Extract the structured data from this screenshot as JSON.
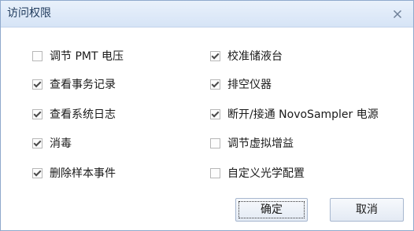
{
  "dialog": {
    "title": "访问权限",
    "close_icon": "close-x-icon"
  },
  "permissions": [
    {
      "label": "调节 PMT 电压",
      "checked": false
    },
    {
      "label": "查看事务记录",
      "checked": true
    },
    {
      "label": "查看系统日志",
      "checked": true
    },
    {
      "label": "消毒",
      "checked": true
    },
    {
      "label": "删除样本事件",
      "checked": true
    },
    {
      "label": "校准储液台",
      "checked": true
    },
    {
      "label": "排空仪器",
      "checked": true
    },
    {
      "label": "断开/接通 NovoSampler 电源",
      "checked": true
    },
    {
      "label": "调节虚拟增益",
      "checked": false
    },
    {
      "label": "自定义光学配置",
      "checked": false
    }
  ],
  "buttons": {
    "ok_label": "确定",
    "cancel_label": "取消"
  },
  "colors": {
    "titlebar": "#dbe7f7",
    "title_text": "#1e395b",
    "border": "#8fa9cc"
  }
}
